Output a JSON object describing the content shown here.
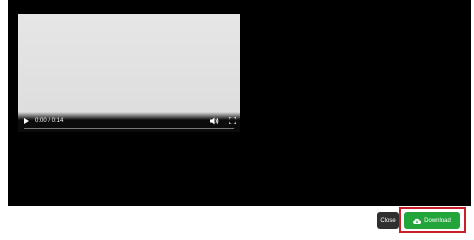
{
  "player": {
    "current_time": "0:00",
    "duration": "0:14",
    "time_display": "0:00 / 0:14",
    "progress": 0.0,
    "icons": [
      "play-icon",
      "volume-icon",
      "fullscreen-icon",
      "more-vert-icon"
    ]
  },
  "footer": {
    "close_label": "Close",
    "download_label": "Download",
    "download_icon": "cloud-download-icon"
  },
  "colors": {
    "preview_background": "#000000",
    "close_button": "#2f2f2f",
    "download_button": "#22a53a",
    "highlight_outline": "#c8202a"
  }
}
